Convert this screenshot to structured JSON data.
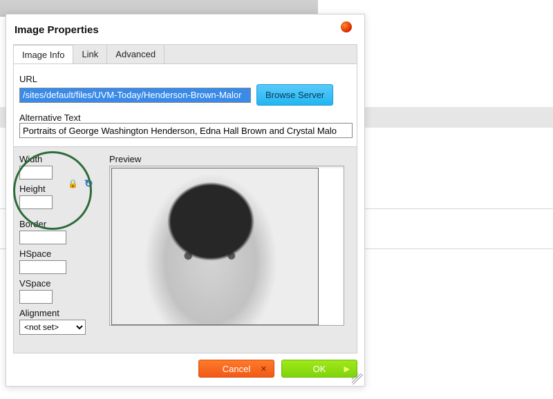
{
  "dialog": {
    "title": "Image Properties",
    "tabs": [
      {
        "label": "Image Info"
      },
      {
        "label": "Link"
      },
      {
        "label": "Advanced"
      }
    ],
    "url_label": "URL",
    "url_value": "/sites/default/files/UVM-Today/Henderson-Brown-Malor",
    "browse_label": "Browse Server",
    "alt_label": "Alternative Text",
    "alt_value": "Portraits of George Washington Henderson, Edna Hall Brown and Crystal Malo",
    "width_label": "Width",
    "width_value": "",
    "height_label": "Height",
    "height_value": "",
    "border_label": "Border",
    "border_value": "",
    "hspace_label": "HSpace",
    "hspace_value": "",
    "vspace_label": "VSpace",
    "vspace_value": "",
    "alignment_label": "Alignment",
    "alignment_value": "<not set>",
    "preview_label": "Preview",
    "cancel_label": "Cancel",
    "ok_label": "OK",
    "lock_glyph": "🔒",
    "reset_glyph": "↻"
  }
}
